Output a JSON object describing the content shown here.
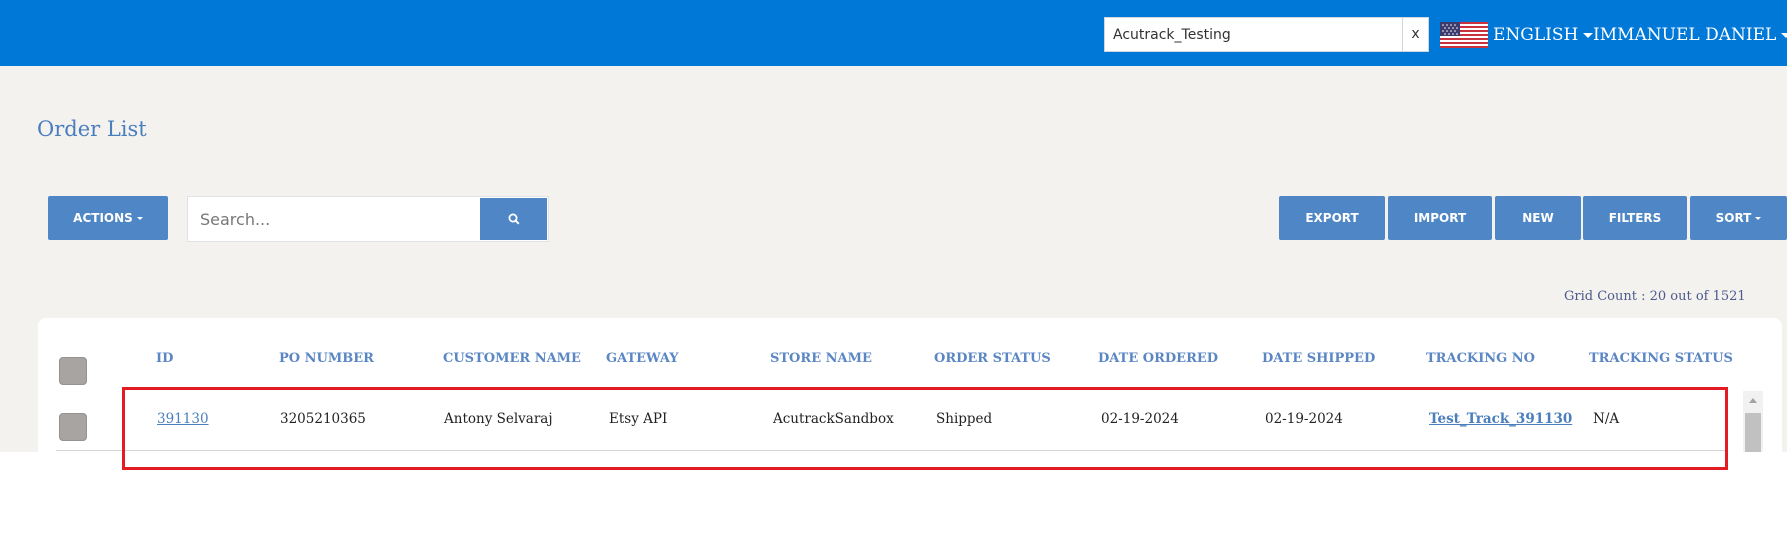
{
  "header": {
    "tenant_search_value": "Acutrack_Testing",
    "clear_label": "x",
    "language_label": "ENGLISH",
    "user_label": "IMMANUEL DANIEL",
    "flag_icon": "us-flag-icon",
    "background_color": "#0078d7"
  },
  "page": {
    "title": "Order List"
  },
  "toolbar": {
    "actions_label": "ACTIONS",
    "search_placeholder": "Search...",
    "search_icon": "search-icon",
    "export_label": "EXPORT",
    "import_label": "IMPORT",
    "new_label": "NEW",
    "filters_label": "FILTERS",
    "sort_label": "SORT"
  },
  "grid": {
    "count_text": "Grid Count : 20 out of 1521",
    "columns": [
      "ID",
      "PO NUMBER",
      "CUSTOMER NAME",
      "GATEWAY",
      "STORE NAME",
      "ORDER STATUS",
      "DATE ORDERED",
      "DATE SHIPPED",
      "TRACKING NO",
      "TRACKING STATUS"
    ],
    "rows": [
      {
        "id": "391130",
        "po_number": "3205210365",
        "customer_name": "Antony Selvaraj",
        "gateway": "Etsy API",
        "store_name": "AcutrackSandbox",
        "order_status": "Shipped",
        "date_ordered": "02-19-2024",
        "date_shipped": "02-19-2024",
        "tracking_no": "Test_Track_391130",
        "tracking_status": "N/A"
      }
    ]
  },
  "colors": {
    "accent": "#4f87c6",
    "link": "#4a7ebd",
    "highlight": "#e31b23"
  }
}
